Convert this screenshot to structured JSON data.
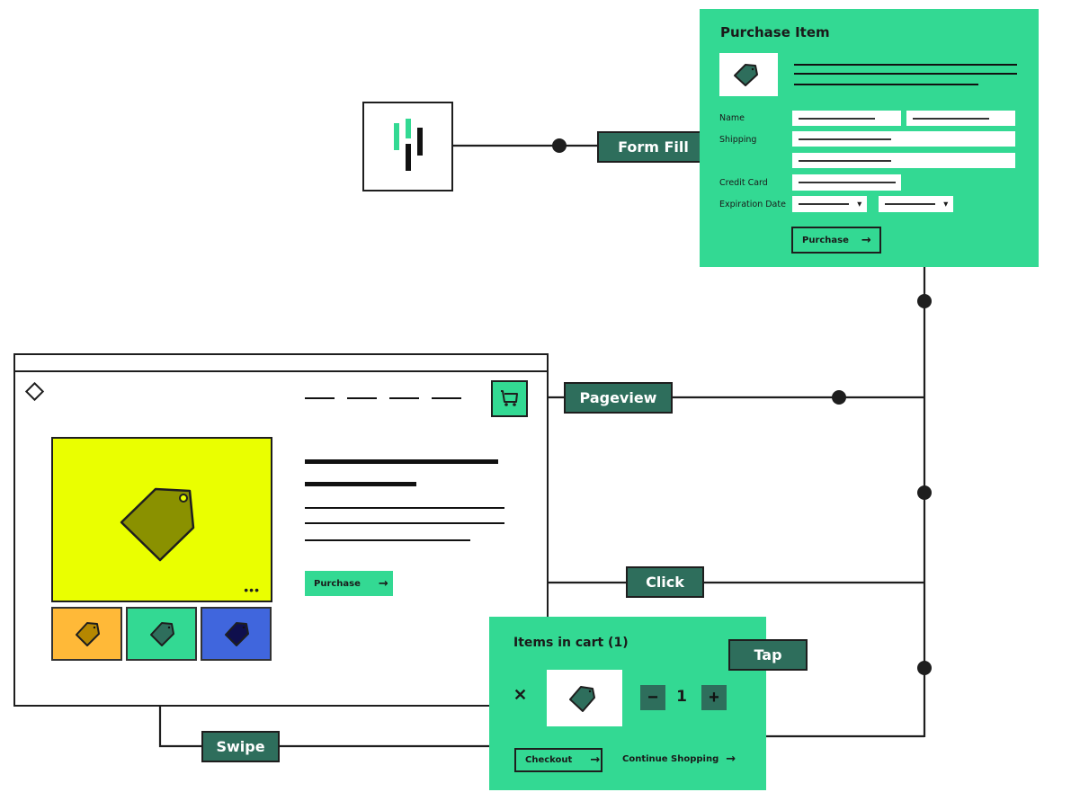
{
  "colors": {
    "green_panel": "#33d993",
    "label_bg": "#2e6e5c",
    "yellow_hero": "#eaff00",
    "orange_thumb": "#ffb938",
    "blue_thumb": "#4066dd",
    "line": "#1e1e1e"
  },
  "events": {
    "form_fill": "Form Fill",
    "pageview": "Pageview",
    "click": "Click",
    "tap": "Tap",
    "swipe": "Swipe"
  },
  "app_logo": {
    "icon": "heap-logo-icon"
  },
  "purchase_form": {
    "title": "Purchase Item",
    "product_icon": "price-tag-icon",
    "fields": {
      "name_label": "Name",
      "shipping_label": "Shipping",
      "credit_card_label": "Credit Card",
      "expiration_label": "Expiration Date"
    },
    "purchase_button": "Purchase",
    "arrow": "→",
    "chevron": "⌄"
  },
  "browser": {
    "logo_icon": "diamond-icon",
    "cart_icon": "shopping-cart-icon",
    "hero_icon": "price-tag-icon",
    "more_icon": "•••",
    "purchase_button": "Purchase",
    "arrow": "→",
    "thumbnails": [
      {
        "name": "orange-variant"
      },
      {
        "name": "green-variant"
      },
      {
        "name": "blue-variant"
      }
    ]
  },
  "cart": {
    "title": "Items in cart (1)",
    "remove": "✕",
    "minus": "−",
    "plus": "+",
    "quantity": "1",
    "checkout_button": "Checkout",
    "continue_link": "Continue Shopping",
    "arrow": "→"
  }
}
